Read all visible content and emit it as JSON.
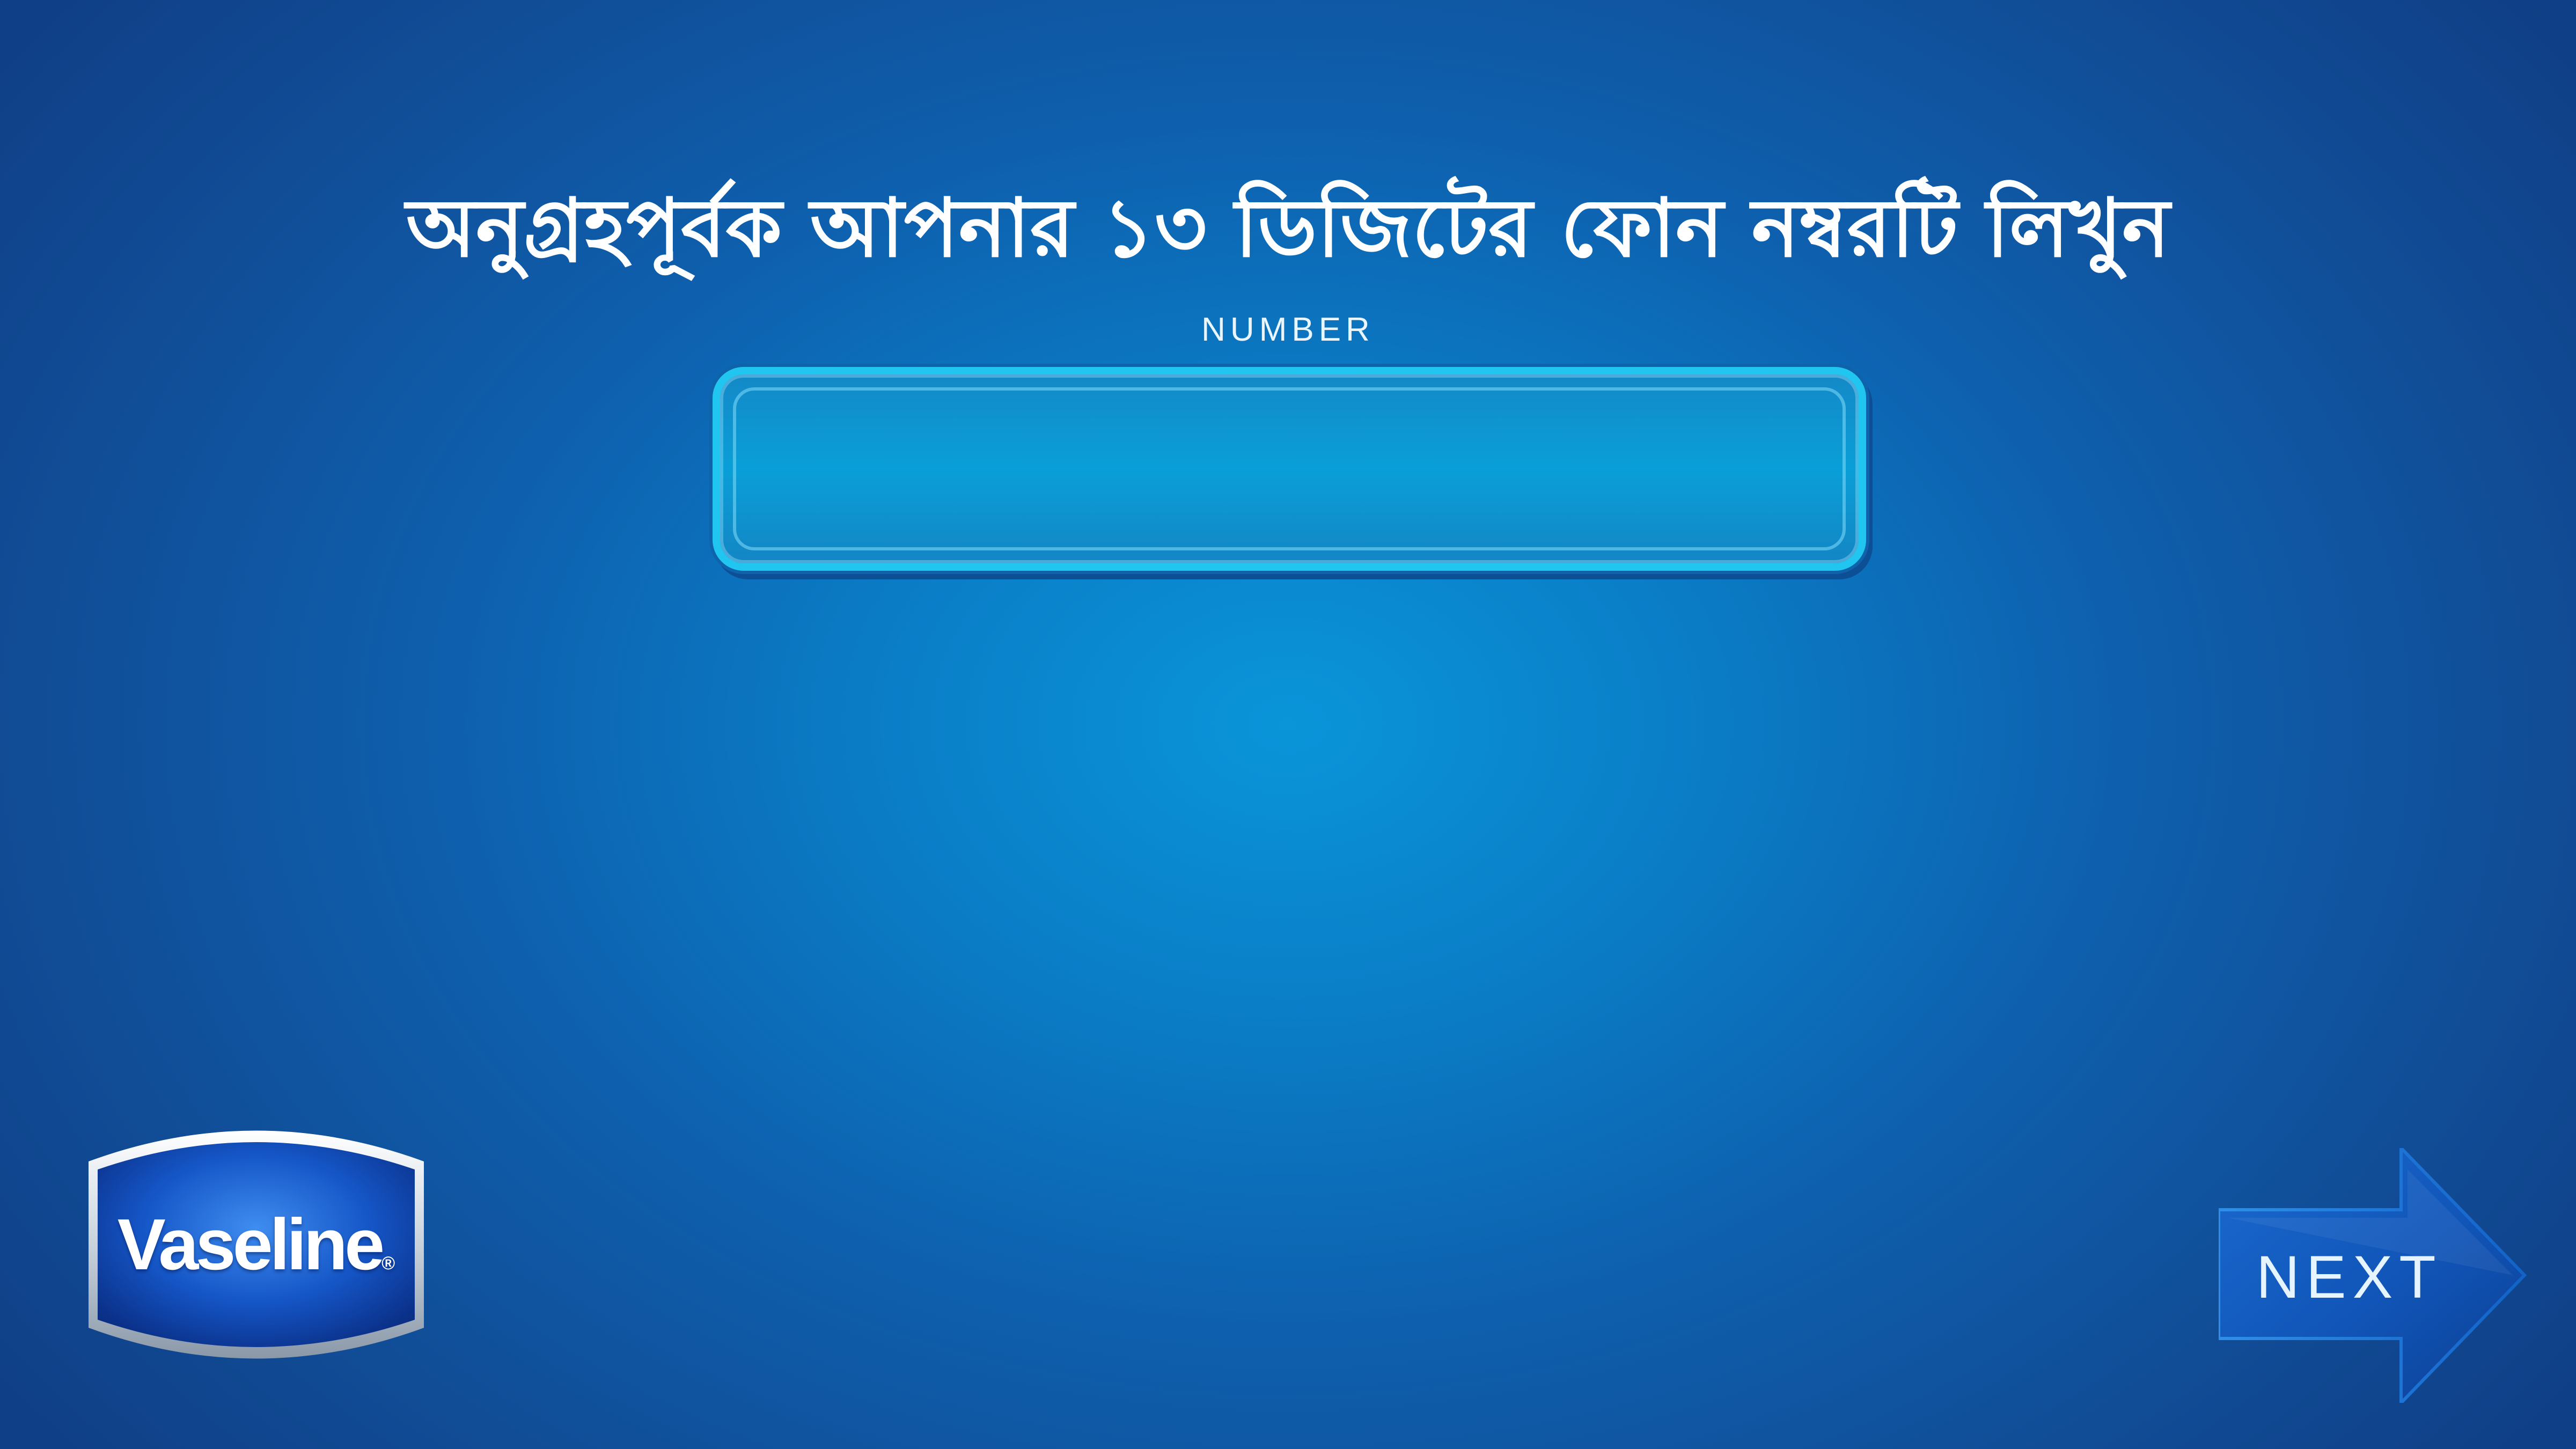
{
  "prompt": {
    "title": "অনুগ্রহপূর্বক আপনার ১৩ ডিজিটের ফোন নম্বরটি লিখুন"
  },
  "phone_field": {
    "label": "NUMBER",
    "value": "",
    "placeholder": ""
  },
  "brand": {
    "name": "Vaseline",
    "registered_mark": "®"
  },
  "navigation": {
    "next_label": "NEXT"
  },
  "icons": {
    "next": "right-arrow-icon",
    "logo": "vaseline-logo"
  },
  "colors": {
    "background_center": "#0a95d9",
    "background_edge": "#0f3f86",
    "input_border": "#20c6ef",
    "text": "#ffffff"
  }
}
